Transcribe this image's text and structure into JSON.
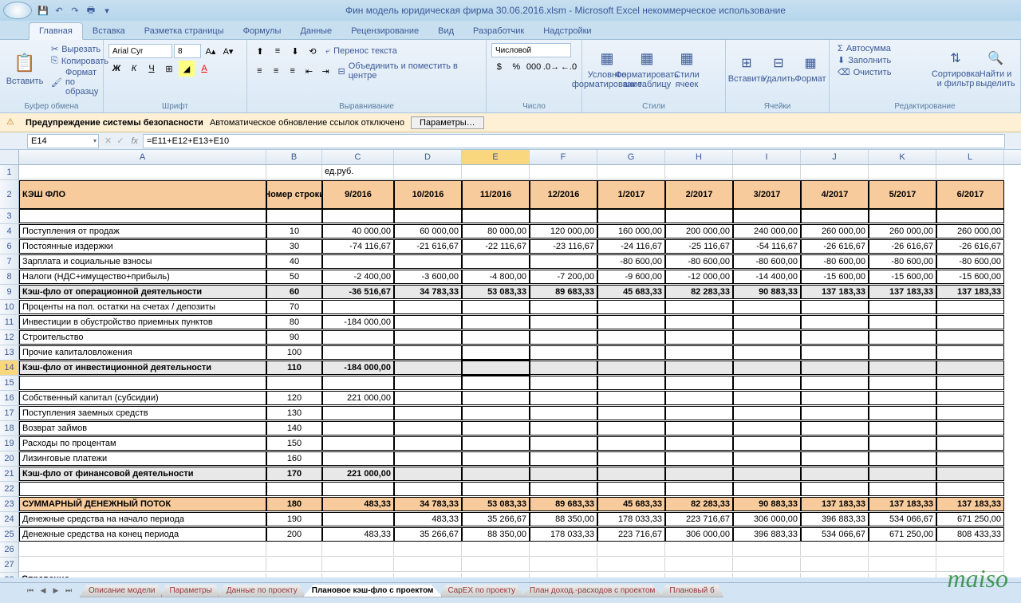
{
  "title": "Фин модель юридическая фирма 30.06.2016.xlsm - Microsoft Excel некоммерческое использование",
  "tabs": [
    "Главная",
    "Вставка",
    "Разметка страницы",
    "Формулы",
    "Данные",
    "Рецензирование",
    "Вид",
    "Разработчик",
    "Надстройки"
  ],
  "activeTab": 0,
  "ribbon": {
    "clipboard": {
      "paste": "Вставить",
      "cut": "Вырезать",
      "copy": "Копировать",
      "fmtPainter": "Формат по образцу",
      "title": "Буфер обмена"
    },
    "font": {
      "name": "Arial Cyr",
      "size": "8",
      "title": "Шрифт"
    },
    "alignment": {
      "wrap": "Перенос текста",
      "merge": "Объединить и поместить в центре",
      "title": "Выравнивание"
    },
    "number": {
      "format": "Числовой",
      "title": "Число"
    },
    "styles": {
      "cond": "Условное форматирование",
      "table": "Форматировать как таблицу",
      "cell": "Стили ячеек",
      "title": "Стили"
    },
    "cells": {
      "insert": "Вставить",
      "delete": "Удалить",
      "format": "Формат",
      "title": "Ячейки"
    },
    "editing": {
      "autosum": "Автосумма",
      "fill": "Заполнить",
      "clear": "Очистить",
      "sort": "Сортировка и фильтр",
      "find": "Найти и выделить",
      "title": "Редактирование"
    }
  },
  "security": {
    "label": "Предупреждение системы безопасности",
    "text": "Автоматическое обновление ссылок отключено",
    "btn": "Параметры…"
  },
  "nameBox": "E14",
  "formula": "=E11+E12+E13+E10",
  "columns": [
    "A",
    "B",
    "C",
    "D",
    "E",
    "F",
    "G",
    "H",
    "I",
    "J",
    "K",
    "L"
  ],
  "unit": "ед.руб.",
  "header": {
    "a": "КЭШ ФЛО",
    "b": "Номер строки",
    "months": [
      "9/2016",
      "10/2016",
      "11/2016",
      "12/2016",
      "1/2017",
      "2/2017",
      "3/2017",
      "4/2017",
      "5/2017",
      "6/2017"
    ]
  },
  "rows": [
    {
      "r": 4,
      "desc": "Поступления от продаж",
      "n": "10",
      "v": [
        "40 000,00",
        "60 000,00",
        "80 000,00",
        "120 000,00",
        "160 000,00",
        "200 000,00",
        "240 000,00",
        "260 000,00",
        "260 000,00",
        "260 000,00"
      ]
    },
    {
      "r": 6,
      "desc": "Постоянные издержки",
      "n": "30",
      "v": [
        "-74 116,67",
        "-21 616,67",
        "-22 116,67",
        "-23 116,67",
        "-24 116,67",
        "-25 116,67",
        "-54 116,67",
        "-26 616,67",
        "-26 616,67",
        "-26 616,67"
      ]
    },
    {
      "r": 7,
      "desc": "Зарплата и социальные взносы",
      "n": "40",
      "v": [
        "",
        "",
        "",
        "",
        "-80 600,00",
        "-80 600,00",
        "-80 600,00",
        "-80 600,00",
        "-80 600,00",
        "-80 600,00"
      ]
    },
    {
      "r": 8,
      "desc": "Налоги (НДС+имущество+прибыль)",
      "n": "50",
      "v": [
        "-2 400,00",
        "-3 600,00",
        "-4 800,00",
        "-7 200,00",
        "-9 600,00",
        "-12 000,00",
        "-14 400,00",
        "-15 600,00",
        "-15 600,00",
        "-15 600,00"
      ]
    },
    {
      "r": 9,
      "desc": "Кэш-фло от операционной деятельности",
      "n": "60",
      "bold": true,
      "v": [
        "-36 516,67",
        "34 783,33",
        "53 083,33",
        "89 683,33",
        "45 683,33",
        "82 283,33",
        "90 883,33",
        "137 183,33",
        "137 183,33",
        "137 183,33"
      ]
    },
    {
      "r": 10,
      "desc": "Проценты на пол. остатки на счетах / депозиты",
      "n": "70",
      "v": [
        "",
        "",
        "",
        "",
        "",
        "",
        "",
        "",
        "",
        ""
      ]
    },
    {
      "r": 11,
      "desc": "Инвестиции в обустройство приемных пунктов",
      "n": "80",
      "v": [
        "-184 000,00",
        "",
        "",
        "",
        "",
        "",
        "",
        "",
        "",
        ""
      ]
    },
    {
      "r": 12,
      "desc": "Строительство",
      "n": "90",
      "v": [
        "",
        "",
        "",
        "",
        "",
        "",
        "",
        "",
        "",
        ""
      ]
    },
    {
      "r": 13,
      "desc": "Прочие капиталовложения",
      "n": "100",
      "v": [
        "",
        "",
        "",
        "",
        "",
        "",
        "",
        "",
        "",
        ""
      ]
    },
    {
      "r": 14,
      "desc": "Кэш-фло от инвестиционной деятельности",
      "n": "110",
      "bold": true,
      "v": [
        "-184 000,00",
        "",
        "",
        "",
        "",
        "",
        "",
        "",
        "",
        ""
      ],
      "sel": 4
    },
    {
      "r": 15,
      "desc": "",
      "n": "",
      "v": [
        "",
        "",
        "",
        "",
        "",
        "",
        "",
        "",
        "",
        ""
      ]
    },
    {
      "r": 16,
      "desc": "Собственный капитал (субсидии)",
      "n": "120",
      "v": [
        "221 000,00",
        "",
        "",
        "",
        "",
        "",
        "",
        "",
        "",
        ""
      ]
    },
    {
      "r": 17,
      "desc": "Поступления заемных средств",
      "n": "130",
      "v": [
        "",
        "",
        "",
        "",
        "",
        "",
        "",
        "",
        "",
        ""
      ]
    },
    {
      "r": 18,
      "desc": "Возврат займов",
      "n": "140",
      "v": [
        "",
        "",
        "",
        "",
        "",
        "",
        "",
        "",
        "",
        ""
      ]
    },
    {
      "r": 19,
      "desc": "Расходы по процентам",
      "n": "150",
      "v": [
        "",
        "",
        "",
        "",
        "",
        "",
        "",
        "",
        "",
        ""
      ]
    },
    {
      "r": 20,
      "desc": "Лизинговые платежи",
      "n": "160",
      "v": [
        "",
        "",
        "",
        "",
        "",
        "",
        "",
        "",
        "",
        ""
      ]
    },
    {
      "r": 21,
      "desc": "Кэш-фло от финансовой деятельности",
      "n": "170",
      "bold": true,
      "v": [
        "221 000,00",
        "",
        "",
        "",
        "",
        "",
        "",
        "",
        "",
        ""
      ]
    },
    {
      "r": 22,
      "desc": "",
      "n": "",
      "v": [
        "",
        "",
        "",
        "",
        "",
        "",
        "",
        "",
        "",
        ""
      ]
    },
    {
      "r": 23,
      "desc": "СУММАРНЫЙ ДЕНЕЖНЫЙ ПОТОК",
      "n": "180",
      "total": true,
      "v": [
        "483,33",
        "34 783,33",
        "53 083,33",
        "89 683,33",
        "45 683,33",
        "82 283,33",
        "90 883,33",
        "137 183,33",
        "137 183,33",
        "137 183,33"
      ]
    },
    {
      "r": 24,
      "desc": "Денежные средства на начало периода",
      "n": "190",
      "v": [
        "",
        "483,33",
        "35 266,67",
        "88 350,00",
        "178 033,33",
        "223 716,67",
        "306 000,00",
        "396 883,33",
        "534 066,67",
        "671 250,00"
      ]
    },
    {
      "r": 25,
      "desc": "Денежные средства на конец периода",
      "n": "200",
      "v": [
        "483,33",
        "35 266,67",
        "88 350,00",
        "178 033,33",
        "223 716,67",
        "306 000,00",
        "396 883,33",
        "534 066,67",
        "671 250,00",
        "808 433,33"
      ]
    },
    {
      "r": 26,
      "desc": "",
      "n": "",
      "v": [
        "",
        "",
        "",
        "",
        "",
        "",
        "",
        "",
        "",
        ""
      ],
      "noborder": true
    },
    {
      "r": 27,
      "desc": "",
      "n": "",
      "v": [
        "",
        "",
        "",
        "",
        "",
        "",
        "",
        "",
        "",
        ""
      ],
      "noborder": true
    },
    {
      "r": 28,
      "desc": "Справочно",
      "n": "",
      "v": [
        "",
        "",
        "",
        "",
        "",
        "",
        "",
        "",
        "",
        ""
      ],
      "noborder": true,
      "sumtext": true
    }
  ],
  "sheetTabs": [
    "Описание модели",
    "Параметры",
    "Данные по проекту",
    "Плановое кэш-фло с проектом",
    "CapEX по проекту",
    "План доход.-расходов с проектом",
    "Плановый б"
  ],
  "activeSheet": 3,
  "watermark": "maiso"
}
